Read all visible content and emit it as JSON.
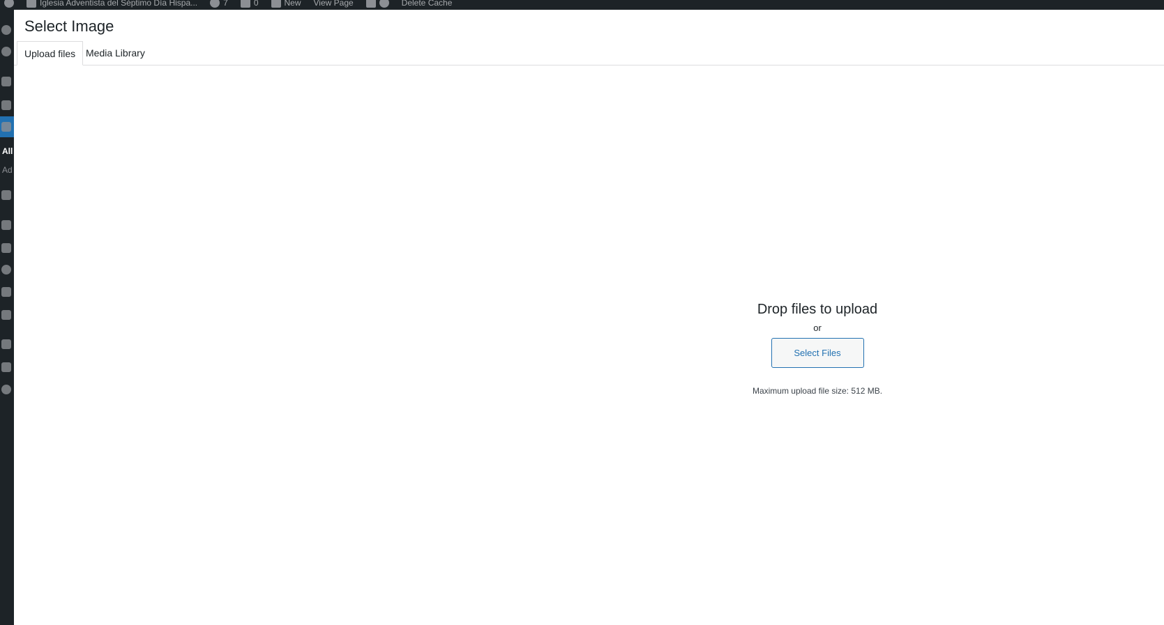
{
  "admin_bar": {
    "site_name": "Iglesia Adventista del Séptimo Día Hispa...",
    "updates_count": "7",
    "comments_count": "0",
    "new_label": "New",
    "view_page_label": "View Page",
    "delete_cache_label": "Delete Cache"
  },
  "sidebar": {
    "pages_submenu_all": "All",
    "pages_submenu_add": "Ad"
  },
  "modal": {
    "title": "Select Image",
    "tabs": [
      {
        "label": "Upload files",
        "active": true
      },
      {
        "label": "Media Library",
        "active": false
      }
    ]
  },
  "uploader": {
    "drop_title": "Drop files to upload",
    "or_text": "or",
    "select_button_label": "Select Files",
    "max_size_text": "Maximum upload file size: 512 MB."
  },
  "colors": {
    "admin_dark": "#1d2327",
    "accent_blue": "#2271b1",
    "border_gray": "#dcdcde"
  }
}
